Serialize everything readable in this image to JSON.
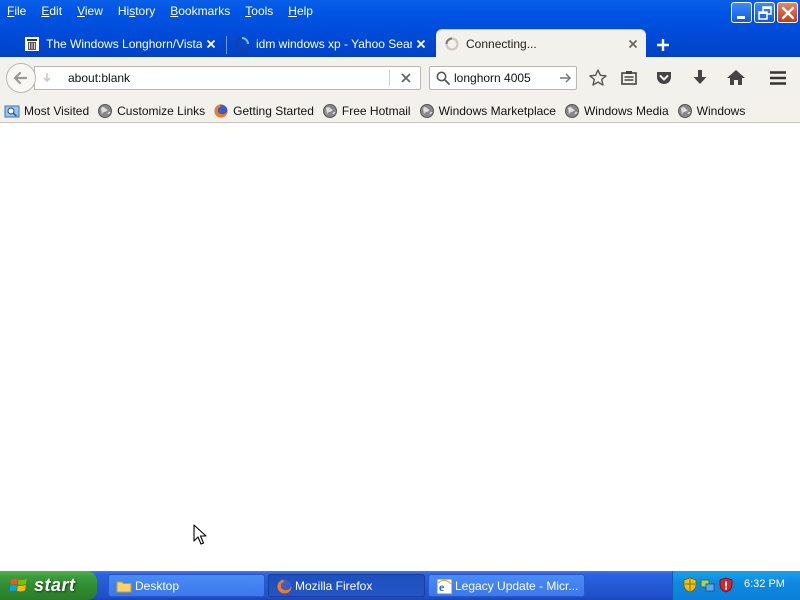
{
  "menu": {
    "items": [
      {
        "pre": "",
        "acc": "F",
        "post": "ile"
      },
      {
        "pre": "",
        "acc": "E",
        "post": "dit"
      },
      {
        "pre": "",
        "acc": "V",
        "post": "iew"
      },
      {
        "pre": "Hi",
        "acc": "s",
        "post": "tory"
      },
      {
        "pre": "",
        "acc": "B",
        "post": "ookmarks"
      },
      {
        "pre": "",
        "acc": "T",
        "post": "ools"
      },
      {
        "pre": "",
        "acc": "H",
        "post": "elp"
      }
    ]
  },
  "tabs": [
    {
      "title": "The Windows Longhorn/Vista ...",
      "icon": "trash-page-icon"
    },
    {
      "title": "idm windows xp - Yahoo Sear...",
      "icon": "loading-spinner-icon"
    },
    {
      "title": "Connecting...",
      "icon": "connecting-throbber-icon",
      "active": true
    }
  ],
  "navbar": {
    "url": "about:blank",
    "search_query": "longhorn 4005"
  },
  "bookmarks": [
    {
      "label": "Most Visited",
      "icon": "folder-search-icon"
    },
    {
      "label": "Customize Links",
      "icon": "globe-icon"
    },
    {
      "label": "Getting Started",
      "icon": "firefox-icon"
    },
    {
      "label": "Free Hotmail",
      "icon": "globe-icon"
    },
    {
      "label": "Windows Marketplace",
      "icon": "globe-icon"
    },
    {
      "label": "Windows Media",
      "icon": "globe-icon"
    },
    {
      "label": "Windows",
      "icon": "globe-icon"
    }
  ],
  "taskbar": {
    "start_label": "start",
    "tasks": [
      {
        "label": "Desktop",
        "icon": "folder-icon"
      },
      {
        "label": "Mozilla Firefox",
        "icon": "firefox-icon",
        "active": true
      },
      {
        "label": "Legacy Update - Micr...",
        "icon": "ie-icon"
      }
    ],
    "clock": "6:32 PM"
  },
  "colors": {
    "xp_blue": "#0055e5",
    "toolbar_bg": "#f3f1ec",
    "start_green": "#3c9a3c"
  }
}
